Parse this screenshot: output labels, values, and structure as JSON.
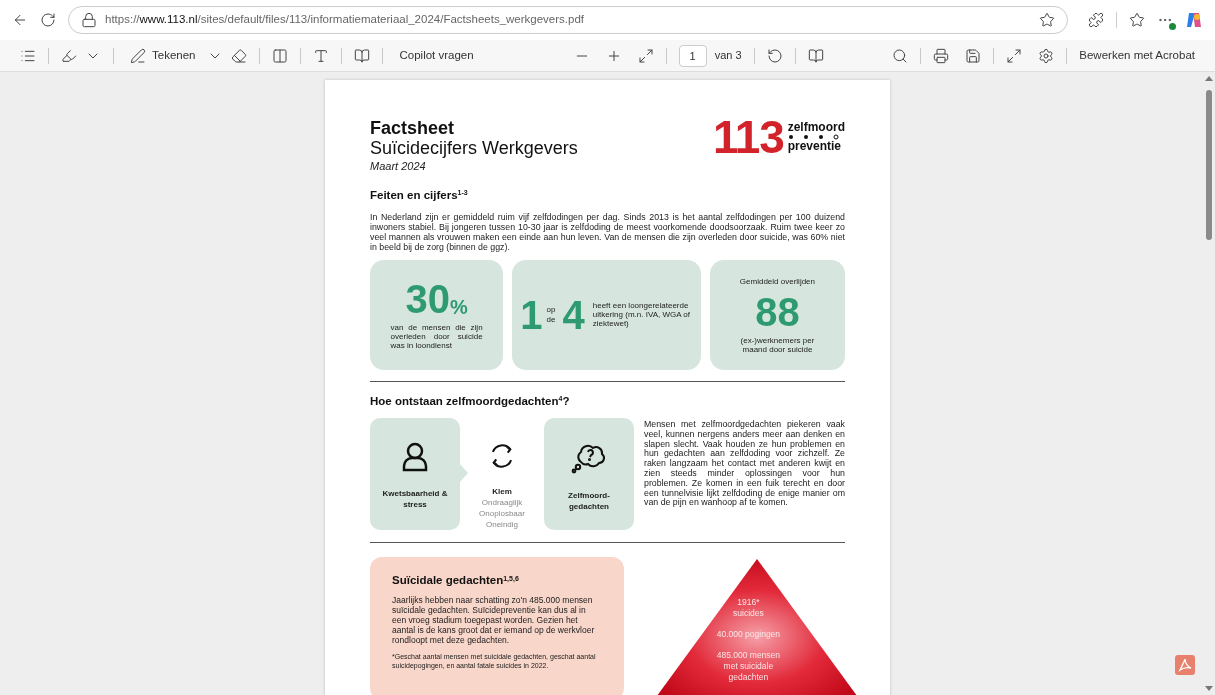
{
  "browser": {
    "url": "https://**www.113.nl**/sites/default/files/113/informatiemateriaal_2024/Factsheets_werkgevers.pdf"
  },
  "pdf_toolbar": {
    "draw_label": "Tekenen",
    "copilot": "Copilot vragen",
    "page": "1",
    "page_count": "van 3",
    "edit": "Bewerken met Acrobat"
  },
  "document": {
    "header": {
      "title": "Factsheet",
      "subtitle": "Suïcidecijfers Werkgevers",
      "date": "Maart 2024",
      "logo_number": "113",
      "logo_top": "zelfmoord",
      "logo_bottom": "preventie"
    },
    "facts": {
      "heading": "Feiten en cijfers$^{1-3}$",
      "text": "In Nederland zijn er gemiddeld ruim vijf zelfdodingen per dag. Sinds 2013 is het aantal zelfdodingen per 100 duizend inwoners stabiel. Bij jongeren tussen 10-30 jaar is zelfdoding de meest voorkomende doodsoorzaak. Ruim twee keer zo veel mannen als vrouwen maken een einde aan hun leven. Van de mensen die zijn overleden door suicide, was 60% niet in beeld bij de zorg (binnen de ggz).",
      "stats": [
        {
          "kind": "percent",
          "value": "30",
          "unit": "%",
          "caption": "van de mensen die zijn overleden door suicide was in loondienst"
        },
        {
          "kind": "ratio",
          "value": "1",
          "between": "op de",
          "value_2": "4",
          "caption": "heeft een loongerelateerde uitkering (m.n. IVA, WGA of ziektewet)"
        },
        {
          "kind": "count",
          "label": "Gemiddeld overlijden",
          "value": "88",
          "caption": "(ex-)werknemers per maand door suicide"
        }
      ]
    },
    "origin": {
      "heading": "Hoe ontstaan zelfmoordgedachten$^{4}$?",
      "steps": [
        {
          "kind": "card",
          "title": "Kwetsbaarheid & stress"
        },
        {
          "kind": "plain",
          "title": "Klem",
          "lines": [
            "Ondraaglijk",
            "Onoplosbaar",
            "Oneindig"
          ]
        },
        {
          "kind": "card",
          "title": "Zelfmoord-gedachten"
        }
      ],
      "text": "Mensen met zelfmoordgedachten piekeren vaak veel, kunnen nergens anders meer aan denken en slapen slecht. Vaak houden ze hun problemen en hun gedachten aan zelfdoding voor zichzelf. Ze raken langzaam het contact met anderen kwijt en zien steeds minder oplossingen voor hun problemen. Ze komen in een fuik terecht en door een tunnelvisie lijkt zelfdoding de enige manier om van de pijn en wanhoop af te komen."
    },
    "suicidal": {
      "heading": "Suïcidale gedachten$^{1,5,6}$",
      "text": "Jaarlijks hebben naar schatting zo'n 485.000 mensen suïcidale gedachten. Suïcidepreventie kan dus al in een vroeg stadium toegepast worden. Gezien het aantal is de kans groot dat er iemand op de werkvloer rondloopt met deze gedachten.",
      "footnote": "*Geschat aantal mensen met suicidale gedachten, geschat aantal suicidepogingen, en aantal fatale suicides in 2022.",
      "pyramid": [
        {
          "lines": [
            "1916*",
            "suicides"
          ]
        },
        {
          "lines": [
            "40.000 pogingen"
          ]
        },
        {
          "lines": [
            "485.000 mensen",
            "met suicidale",
            "gedachten"
          ]
        }
      ]
    }
  }
}
